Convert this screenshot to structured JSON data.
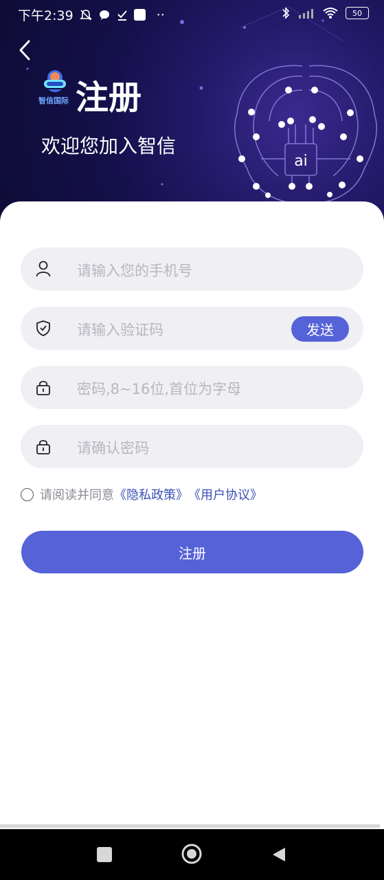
{
  "status": {
    "time": "下午2:39",
    "dots": "··",
    "battery": "50"
  },
  "header": {
    "title": "注册",
    "subtitle": "欢迎您加入智信",
    "logo_text": "智信国际",
    "brain_chip_text": "ai"
  },
  "form": {
    "phone_placeholder": "请输入您的手机号",
    "code_placeholder": "请输入验证码",
    "send_label": "发送",
    "password_placeholder": "密码,8~16位,首位为字母",
    "confirm_placeholder": "请确认密码"
  },
  "agreement": {
    "prefix": "请阅读并同意",
    "privacy": "《隐私政策》",
    "terms": "《用户协议》"
  },
  "register_label": "注册",
  "colors": {
    "accent": "#5562d8",
    "link": "#3a4fb5",
    "field_bg": "#efeff4",
    "hero_dark": "#14104a"
  }
}
